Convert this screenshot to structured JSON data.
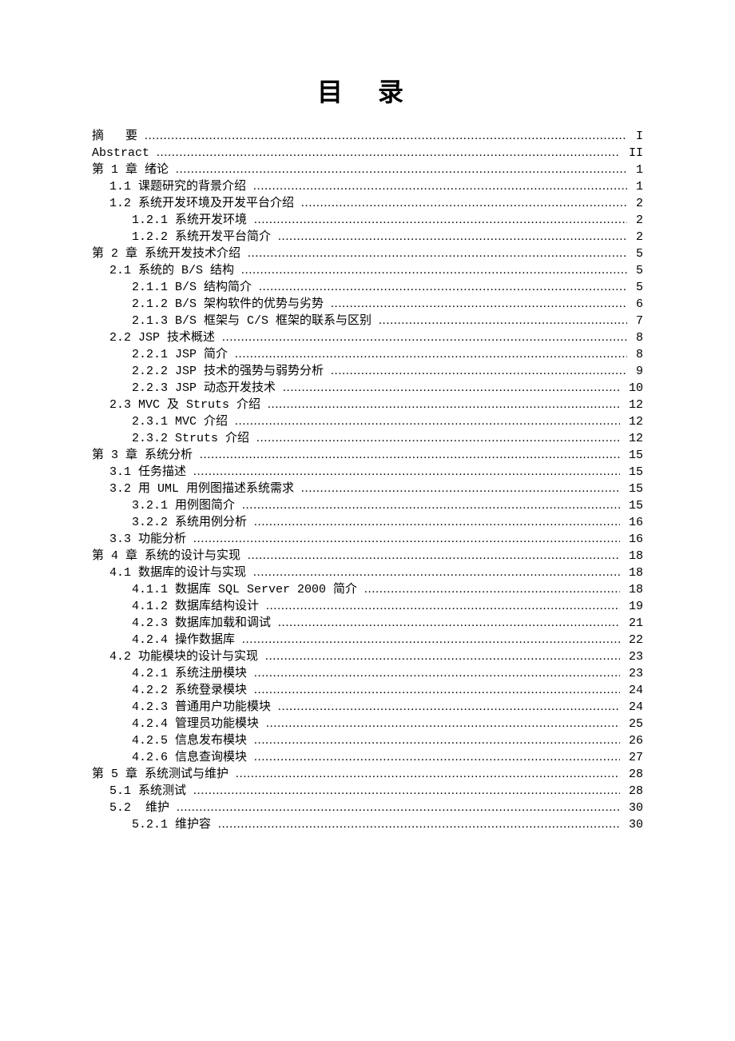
{
  "title": "目 录",
  "toc": [
    {
      "level": 0,
      "label": "摘   要",
      "page": "I"
    },
    {
      "level": 0,
      "label": "Abstract",
      "page": "II"
    },
    {
      "level": 0,
      "label": "第 1 章 绪论",
      "page": "1"
    },
    {
      "level": 1,
      "label": "1.1 课题研究的背景介绍",
      "page": "1"
    },
    {
      "level": 1,
      "label": "1.2 系统开发环境及开发平台介绍",
      "page": "2"
    },
    {
      "level": 2,
      "label": "1.2.1 系统开发环境",
      "page": "2"
    },
    {
      "level": 2,
      "label": "1.2.2 系统开发平台简介",
      "page": "2"
    },
    {
      "level": 0,
      "label": "第 2 章 系统开发技术介绍",
      "page": "5"
    },
    {
      "level": 1,
      "label": "2.1 系统的 B/S 结构",
      "page": "5"
    },
    {
      "level": 2,
      "label": "2.1.1 B/S 结构简介",
      "page": "5"
    },
    {
      "level": 2,
      "label": "2.1.2 B/S 架构软件的优势与劣势",
      "page": "6"
    },
    {
      "level": 2,
      "label": "2.1.3 B/S 框架与 C/S 框架的联系与区别",
      "page": "7"
    },
    {
      "level": 1,
      "label": "2.2 JSP 技术概述",
      "page": "8"
    },
    {
      "level": 2,
      "label": "2.2.1 JSP 简介",
      "page": "8"
    },
    {
      "level": 2,
      "label": "2.2.2 JSP 技术的强势与弱势分析",
      "page": "9"
    },
    {
      "level": 2,
      "label": "2.2.3 JSP 动态开发技术",
      "page": "10"
    },
    {
      "level": 1,
      "label": "2.3 MVC 及 Struts 介绍",
      "page": "12"
    },
    {
      "level": 2,
      "label": "2.3.1 MVC 介绍",
      "page": "12"
    },
    {
      "level": 2,
      "label": "2.3.2 Struts 介绍",
      "page": "12"
    },
    {
      "level": 0,
      "label": "第 3 章 系统分析",
      "page": "15"
    },
    {
      "level": 1,
      "label": "3.1 任务描述",
      "page": "15"
    },
    {
      "level": 1,
      "label": "3.2 用 UML 用例图描述系统需求",
      "page": "15"
    },
    {
      "level": 2,
      "label": "3.2.1 用例图简介",
      "page": "15"
    },
    {
      "level": 2,
      "label": "3.2.2 系统用例分析",
      "page": "16"
    },
    {
      "level": 1,
      "label": "3.3 功能分析",
      "page": "16"
    },
    {
      "level": 0,
      "label": "第 4 章 系统的设计与实现",
      "page": "18"
    },
    {
      "level": 1,
      "label": "4.1 数据库的设计与实现",
      "page": "18"
    },
    {
      "level": 2,
      "label": "4.1.1 数据库 SQL Server 2000 简介",
      "page": "18"
    },
    {
      "level": 2,
      "label": "4.1.2 数据库结构设计",
      "page": "19"
    },
    {
      "level": 2,
      "label": "4.2.3 数据库加载和调试",
      "page": "21"
    },
    {
      "level": 2,
      "label": "4.2.4 操作数据库",
      "page": "22"
    },
    {
      "level": 1,
      "label": "4.2 功能模块的设计与实现",
      "page": "23"
    },
    {
      "level": 2,
      "label": "4.2.1 系统注册模块",
      "page": "23"
    },
    {
      "level": 2,
      "label": "4.2.2 系统登录模块",
      "page": "24"
    },
    {
      "level": 2,
      "label": "4.2.3 普通用户功能模块",
      "page": "24"
    },
    {
      "level": 2,
      "label": "4.2.4 管理员功能模块",
      "page": "25"
    },
    {
      "level": 2,
      "label": "4.2.5 信息发布模块",
      "page": "26"
    },
    {
      "level": 2,
      "label": "4.2.6 信息查询模块",
      "page": "27"
    },
    {
      "level": 0,
      "label": "第 5 章 系统测试与维护",
      "page": "28"
    },
    {
      "level": 1,
      "label": "5.1 系统测试",
      "page": "28"
    },
    {
      "level": 1,
      "label": "5.2  维护",
      "page": "30"
    },
    {
      "level": 2,
      "label": "5.2.1 维护容",
      "page": "30"
    }
  ]
}
